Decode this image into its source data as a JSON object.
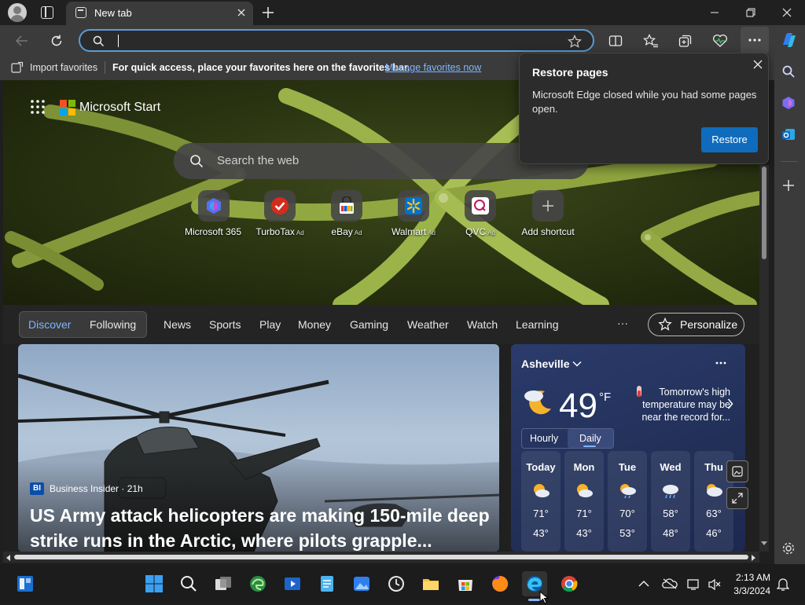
{
  "browser": {
    "tab_title": "New tab",
    "address_value": "",
    "favorites_bar": {
      "import_label": "Import favorites",
      "hint": "For quick access, place your favorites here on the favorites bar.",
      "manage_link": "Manage favorites now"
    }
  },
  "popup": {
    "title": "Restore pages",
    "message": "Microsoft Edge closed while you had some pages open.",
    "restore_label": "Restore"
  },
  "start": {
    "brand": "Microsoft Start",
    "search_placeholder": "Search the web",
    "shortcuts": [
      {
        "label": "Microsoft 365",
        "ad": ""
      },
      {
        "label": "TurboTax",
        "ad": "Ad"
      },
      {
        "label": "eBay",
        "ad": "Ad"
      },
      {
        "label": "Walmart",
        "ad": "Ad"
      },
      {
        "label": "QVC",
        "ad": "Ad"
      },
      {
        "label": "Add shortcut",
        "ad": ""
      }
    ],
    "nav": {
      "discover": "Discover",
      "following": "Following",
      "items": [
        "News",
        "Sports",
        "Play",
        "Money",
        "Gaming",
        "Weather",
        "Watch",
        "Learning"
      ],
      "more": "···",
      "personalize": "Personalize"
    }
  },
  "story": {
    "source_logo": "BI",
    "source": "Business Insider · 21h",
    "headline": "US Army attack helicopters are making 150-mile deep strike runs in the Arctic, where pilots grapple..."
  },
  "weather": {
    "location": "Asheville",
    "temp": "49",
    "unit": "°F",
    "note": "Tomorrow's high temperature may be near the record for...",
    "tab_hourly": "Hourly",
    "tab_daily": "Daily",
    "days": [
      {
        "name": "Today",
        "high": "71°",
        "low": "43°"
      },
      {
        "name": "Mon",
        "high": "71°",
        "low": "43°"
      },
      {
        "name": "Tue",
        "high": "70°",
        "low": "53°"
      },
      {
        "name": "Wed",
        "high": "58°",
        "low": "48°"
      },
      {
        "name": "Thu",
        "high": "63°",
        "low": "46°"
      }
    ]
  },
  "taskbar": {
    "time": "2:13 AM",
    "date": "3/3/2024"
  },
  "colors": {
    "accent": "#0f6cbd",
    "link": "#7eb6ff",
    "address_border": "#5b9bd5"
  }
}
